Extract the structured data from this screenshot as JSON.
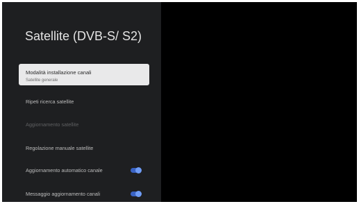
{
  "panel": {
    "title": "Satellite (DVB-S/ S2)"
  },
  "menu": {
    "items": [
      {
        "label": "Modalità installazione canali",
        "sublabel": "Satellite generale"
      },
      {
        "label": "Ripeti ricerca satellite"
      },
      {
        "label": "Aggiornamento satellite"
      },
      {
        "label": "Regolazione manuale satellite"
      },
      {
        "label": "Aggiornamento automatico canale",
        "toggle": "on"
      },
      {
        "label": "Messaggio aggiornamento canali",
        "toggle": "on"
      }
    ]
  },
  "colors": {
    "panel_background": "#1e1f21",
    "screen_background": "#000000",
    "selected_background": "#e9e9ea",
    "toggle_track": "#3a63c4",
    "toggle_knob": "#6f9cf5"
  }
}
